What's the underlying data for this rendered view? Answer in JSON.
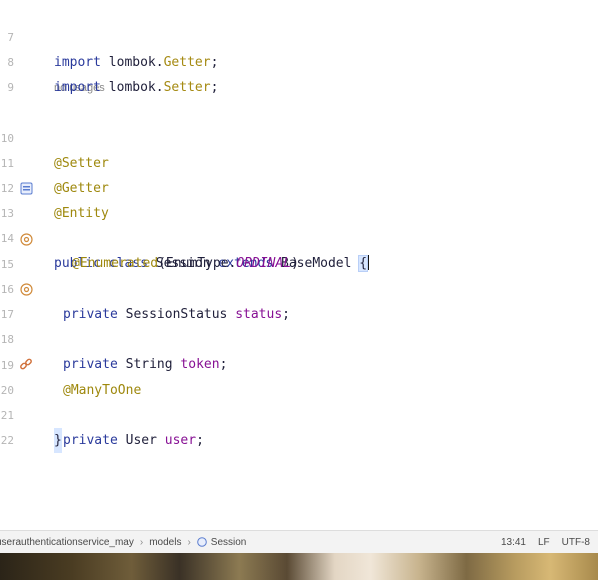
{
  "editor": {
    "lines": [
      {
        "n": "7"
      },
      {
        "n": "8"
      },
      {
        "n": "9"
      },
      {
        "n": "10"
      },
      {
        "n": "11"
      },
      {
        "n": "12"
      },
      {
        "n": "13"
      },
      {
        "n": "14"
      },
      {
        "n": "15"
      },
      {
        "n": "16"
      },
      {
        "n": "17"
      },
      {
        "n": "18"
      },
      {
        "n": "19"
      },
      {
        "n": "20"
      },
      {
        "n": "21"
      },
      {
        "n": "22"
      }
    ],
    "hint": "no usages",
    "tokens": {
      "import": "import",
      "lombok_pkg": "lombok.",
      "getter_cls": "Getter",
      "setter_cls": "Setter",
      "semicolon": ";",
      "setter_annot": "@Setter",
      "getter_annot": "@Getter",
      "entity_annot": "@Entity",
      "public": "public",
      "class": "class",
      "session": "Session",
      "extends": "extends",
      "basemodel": "BaseModel",
      "open_brace": "{",
      "enumerated_annot": "@Enumerated",
      "enumtype_call": "(EnumType.",
      "ordinal": "ORDINAL",
      "close_paren": ")",
      "private": "private",
      "session_status_type": "SessionStatus",
      "status_field": "status",
      "string_type": "String",
      "token_field": "token",
      "manytoone_annot": "@ManyToOne",
      "user_type": "User",
      "user_field": "user",
      "close_brace": "}"
    }
  },
  "statusbar": {
    "breadcrumb": [
      "userauthenticationservice_may",
      "models",
      "Session"
    ],
    "position": "13:41",
    "line_separator": "LF",
    "encoding": "UTF-8"
  },
  "colors": {
    "keyword": "#2a3a9c",
    "annotation": "#9e880d",
    "field": "#871094",
    "background": "#ffffff"
  },
  "icons": [
    "class-icon",
    "field-annotation-icon",
    "field-annotation-icon",
    "relation-link-icon",
    "breadcrumb-class-icon"
  ]
}
